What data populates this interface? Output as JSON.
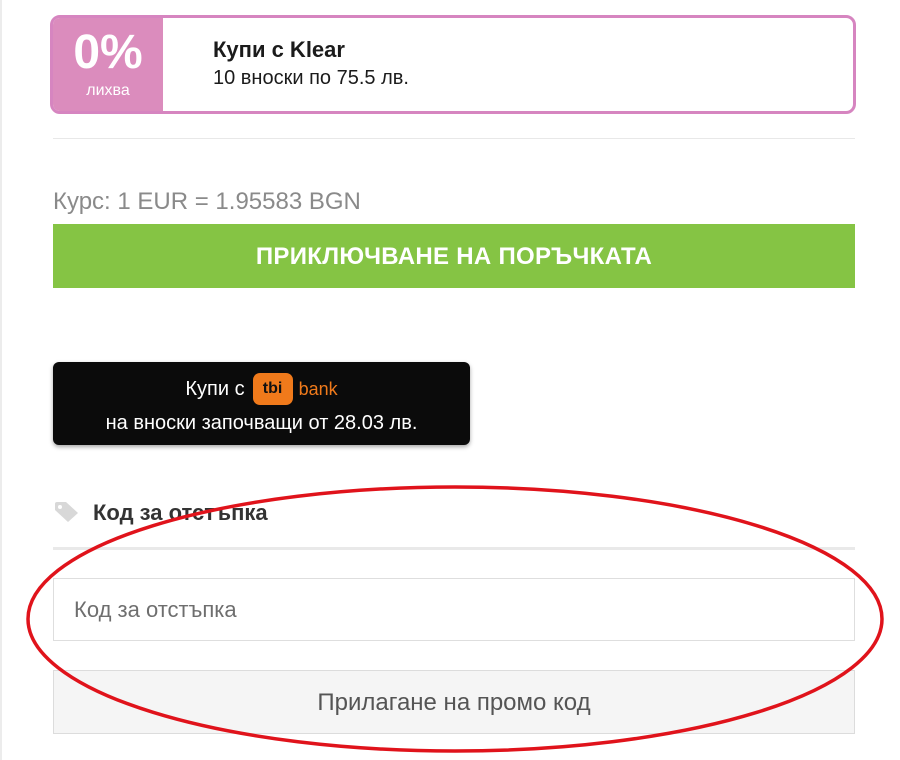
{
  "klear": {
    "percent": "0%",
    "badge_label": "лихва",
    "title": "Купи с Klear",
    "subtitle": "10 вноски по 75.5 лв."
  },
  "exchange_rate": "Курс: 1 EUR = 1.95583 BGN",
  "checkout_button_label": "ПРИКЛЮЧВАНЕ НА ПОРЪЧКАТА",
  "tbi": {
    "buy_label": "Купи с",
    "logo_text": "tbi",
    "bank_text": "bank",
    "installments_text": "на вноски започващи от 28.03 лв."
  },
  "coupon": {
    "heading": "Код за отстъпка",
    "input_placeholder": "Код за отстъпка",
    "input_value": "",
    "apply_button_label": "Прилагане на промо код"
  },
  "colors": {
    "klear_pink": "#db8cbd",
    "checkout_green": "#85c444",
    "tbi_orange": "#f07a1b",
    "highlight_red": "#e0131b"
  },
  "icons": {
    "coupon_heading_icon": "tag-icon"
  }
}
